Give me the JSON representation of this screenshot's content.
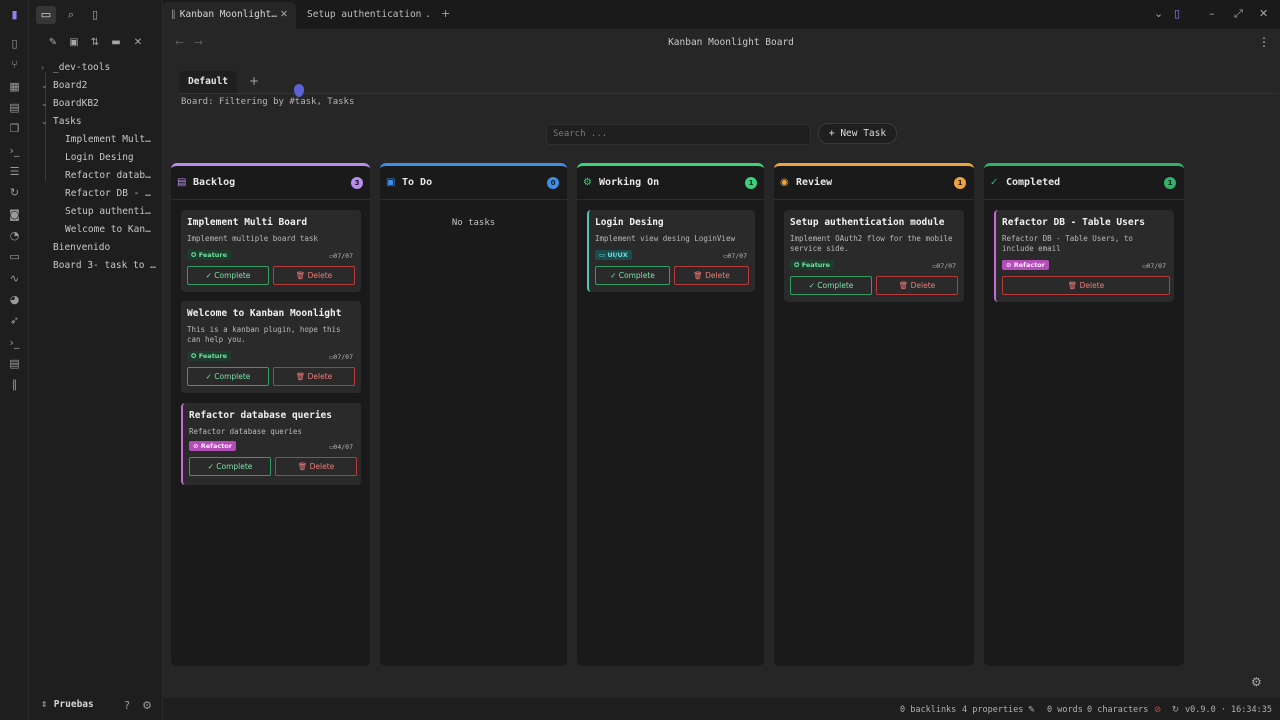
{
  "ribbon": {
    "icons": [
      "sidebar-toggle-icon",
      "file-icon",
      "graph-icon",
      "grid-icon",
      "calendar-icon",
      "pages-icon",
      "terminal-icon",
      "list-icon",
      "sync-icon",
      "camera-icon",
      "history-icon",
      "comment-icon",
      "pulse-icon",
      "palette-icon",
      "rocket-icon",
      "console-icon",
      "template-icon",
      "kanban-icon"
    ]
  },
  "sidebar": {
    "tree": [
      {
        "label": "_dev-tools",
        "chevron": "›",
        "level": 0
      },
      {
        "label": "Board2",
        "chevron": "⌄",
        "level": 0
      },
      {
        "label": "BoardKB2",
        "chevron": "⌄",
        "level": 0
      },
      {
        "label": "Tasks",
        "chevron": "⌄",
        "level": 0
      },
      {
        "label": "Implement Mult…",
        "chevron": "",
        "level": 1
      },
      {
        "label": "Login Desing",
        "chevron": "",
        "level": 1
      },
      {
        "label": "Refactor datab…",
        "chevron": "",
        "level": 1
      },
      {
        "label": "Refactor DB - …",
        "chevron": "",
        "level": 1
      },
      {
        "label": "Setup authenti…",
        "chevron": "",
        "level": 1
      },
      {
        "label": "Welcome to Kan…",
        "chevron": "",
        "level": 1
      },
      {
        "label": "Bienvenido",
        "chevron": "",
        "level": 0
      },
      {
        "label": "Board 3- task to …",
        "chevron": "",
        "level": 0
      }
    ],
    "vault_name": "Pruebas"
  },
  "tabs": [
    {
      "label": "Kanban Moonlight…",
      "icon": "kanban-icon",
      "active": true
    },
    {
      "label": "Setup authentication …",
      "icon": "",
      "active": false
    }
  ],
  "view": {
    "title": "Kanban Moonlight Board"
  },
  "board": {
    "tab_label": "Default",
    "add_label": "+",
    "filter_text": "Board: Filtering by #task, Tasks",
    "search_placeholder": "Search ...",
    "new_task_label": "+ New Task",
    "buttons": {
      "complete": "✓ Complete",
      "delete": "🗑 Delete"
    }
  },
  "columns": [
    {
      "title": "Backlog",
      "count": "3",
      "color": "#b98cf0",
      "icon": "▤",
      "empty_text": ""
    },
    {
      "title": "To Do",
      "count": "0",
      "color": "#3d8ee8",
      "icon": "▣",
      "empty_text": "No tasks"
    },
    {
      "title": "Working On",
      "count": "1",
      "color": "#38d47a",
      "icon": "⚙",
      "empty_text": ""
    },
    {
      "title": "Review",
      "count": "1",
      "color": "#f0a43a",
      "icon": "◉",
      "empty_text": ""
    },
    {
      "title": "Completed",
      "count": "1",
      "color": "#2fb368",
      "icon": "✓",
      "empty_text": ""
    }
  ],
  "cards": {
    "backlog": [
      {
        "title": "Implement Multi Board",
        "description": "Implement multiple board task",
        "tag": "Feature",
        "date": "07/07"
      },
      {
        "title": "Welcome to Kanban Moonlight",
        "description": "This is a kanban plugin, hope this can help you.",
        "tag": "Feature",
        "date": "07/07"
      },
      {
        "title": "Refactor database queries",
        "description": "Refactor database queries",
        "tag": "Refactor",
        "date": "04/07"
      }
    ],
    "working": [
      {
        "title": "Login Desing",
        "description": "Implement view desing LoginView",
        "tag": "UI/UX",
        "date": "07/07"
      }
    ],
    "review": [
      {
        "title": "Setup authentication module",
        "description": "Implement OAuth2 flow for the mobile service side.",
        "tag": "Feature",
        "date": "07/07"
      }
    ],
    "completed": [
      {
        "title": "Refactor DB - Table Users",
        "description": "Refactor DB - Table Users, to include email",
        "tag": "Refactor",
        "date": "07/07"
      }
    ]
  },
  "statusbar": {
    "backlinks": "0 backlinks",
    "properties": "4 properties",
    "words": "0 words",
    "characters": "0 characters",
    "version": "v0.9.0 · 16:34:35"
  }
}
